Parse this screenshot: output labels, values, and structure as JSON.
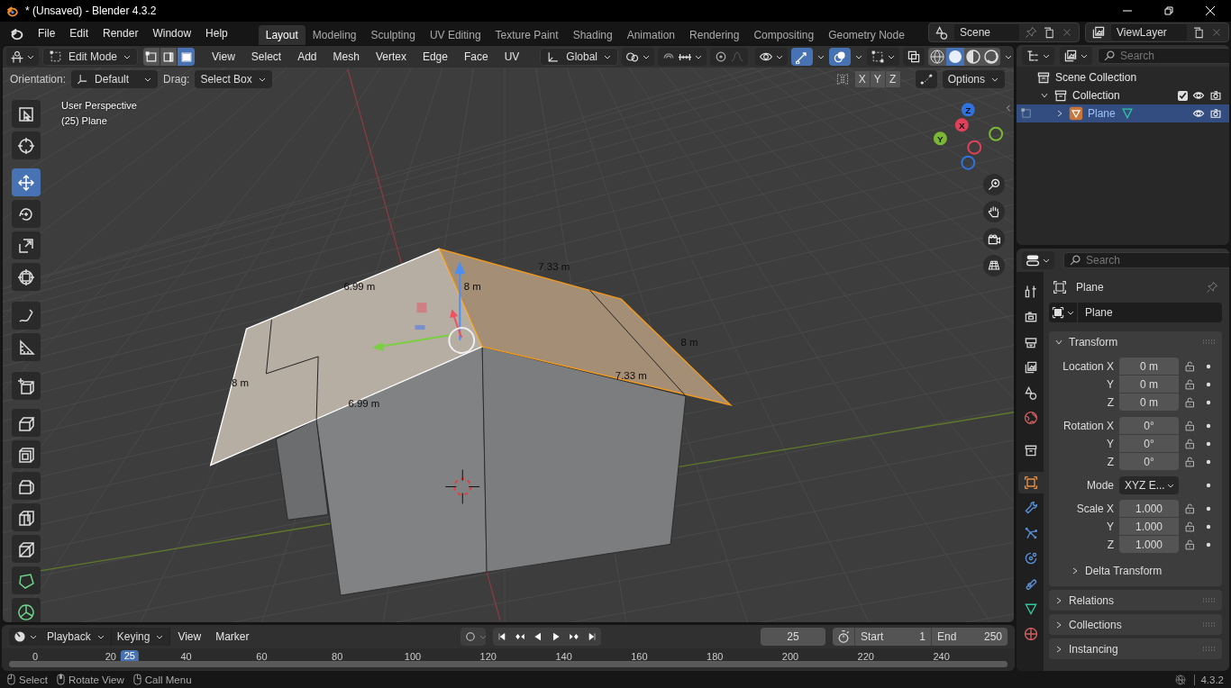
{
  "window": {
    "title": "* (Unsaved) - Blender 4.3.2"
  },
  "menu": [
    "File",
    "Edit",
    "Render",
    "Window",
    "Help"
  ],
  "workspaces": [
    {
      "label": "Layout",
      "selected": true
    },
    {
      "label": "Modeling",
      "selected": false
    },
    {
      "label": "Sculpting",
      "selected": false
    },
    {
      "label": "UV Editing",
      "selected": false
    },
    {
      "label": "Texture Paint",
      "selected": false
    },
    {
      "label": "Shading",
      "selected": false
    },
    {
      "label": "Animation",
      "selected": false
    },
    {
      "label": "Rendering",
      "selected": false
    },
    {
      "label": "Compositing",
      "selected": false
    },
    {
      "label": "Geometry Node",
      "selected": false
    }
  ],
  "scene": {
    "value": "Scene"
  },
  "view_layer": {
    "value": "ViewLayer"
  },
  "viewport_header": {
    "mode": "Edit Mode",
    "select_modes": [
      {
        "kind": "vertex",
        "selected": false
      },
      {
        "kind": "edge",
        "selected": false
      },
      {
        "kind": "face",
        "selected": true
      }
    ],
    "menus": [
      "View",
      "Select",
      "Add",
      "Mesh",
      "Vertex",
      "Edge",
      "Face",
      "UV"
    ],
    "transform_orientation": "Global"
  },
  "tool_settings": {
    "orientation_label": "Orientation:",
    "orientation": "Default",
    "drag_label": "Drag:",
    "drag": "Select Box",
    "axes": [
      "X",
      "Y",
      "Z"
    ],
    "options": "Options"
  },
  "viewport": {
    "view_name": "User Perspective",
    "object_info": "(25) Plane",
    "measurements": [
      "6.99 m",
      "8 m",
      "7.33 m",
      "8 m",
      "7.33 m",
      "8 m",
      "6.99 m"
    ],
    "gizmo_axes": [
      "Z",
      "X",
      "Y"
    ]
  },
  "toolbar": [
    {
      "kind": "select",
      "selected": false
    },
    {
      "kind": "cursor",
      "selected": false
    },
    {
      "kind": "move",
      "selected": true
    },
    {
      "kind": "rotate",
      "selected": false
    },
    {
      "kind": "scale",
      "selected": false
    },
    {
      "kind": "transform",
      "selected": false
    },
    {
      "kind": "annotate",
      "selected": false
    },
    {
      "kind": "measure",
      "selected": false
    },
    {
      "kind": "add_cube",
      "selected": false
    },
    {
      "kind": "extrude",
      "selected": false
    },
    {
      "kind": "inset",
      "selected": false
    },
    {
      "kind": "bevel",
      "selected": false
    },
    {
      "kind": "loop_cut",
      "selected": false
    },
    {
      "kind": "knife",
      "selected": false
    },
    {
      "kind": "poly_build",
      "selected": false
    },
    {
      "kind": "spin",
      "selected": false
    }
  ],
  "outliner": {
    "search_placeholder": "Search",
    "tree": [
      {
        "label": "Scene Collection",
        "children": [
          {
            "label": "Collection",
            "expanded": true,
            "checked": true,
            "children": [
              {
                "label": "Plane",
                "expanded": false,
                "selected": true
              }
            ]
          }
        ]
      }
    ]
  },
  "properties": {
    "search_placeholder": "Search",
    "object_name": "Plane",
    "data_name": "Plane",
    "tabs": [
      {
        "kind": "tool",
        "selected": false
      },
      {
        "kind": "render",
        "selected": false
      },
      {
        "kind": "output",
        "selected": false
      },
      {
        "kind": "view_layer",
        "selected": false
      },
      {
        "kind": "scene",
        "selected": false
      },
      {
        "kind": "world",
        "selected": false
      },
      {
        "kind": "collection",
        "selected": false
      },
      {
        "kind": "object",
        "selected": true
      },
      {
        "kind": "modifiers",
        "selected": false
      },
      {
        "kind": "particles",
        "selected": false
      },
      {
        "kind": "physics",
        "selected": false
      },
      {
        "kind": "constraints",
        "selected": false
      },
      {
        "kind": "data",
        "selected": false
      },
      {
        "kind": "material",
        "selected": false
      }
    ],
    "transform": {
      "title": "Transform",
      "expanded": true,
      "location": [
        {
          "label": "Location X",
          "value": "0 m"
        },
        {
          "label": "Y",
          "value": "0 m"
        },
        {
          "label": "Z",
          "value": "0 m"
        }
      ],
      "rotation": [
        {
          "label": "Rotation X",
          "value": "0°"
        },
        {
          "label": "Y",
          "value": "0°"
        },
        {
          "label": "Z",
          "value": "0°"
        }
      ],
      "mode": {
        "label": "Mode",
        "value": "XYZ E..."
      },
      "scale": [
        {
          "label": "Scale X",
          "value": "1.000"
        },
        {
          "label": "Y",
          "value": "1.000"
        },
        {
          "label": "Z",
          "value": "1.000"
        }
      ],
      "delta": {
        "title": "Delta Transform",
        "expanded": false
      }
    },
    "panels": [
      {
        "title": "Relations",
        "expanded": false
      },
      {
        "title": "Collections",
        "expanded": false
      },
      {
        "title": "Instancing",
        "expanded": false
      }
    ]
  },
  "timeline": {
    "menus": [
      "Playback",
      "Keying",
      "View",
      "Marker"
    ],
    "current_frame": "25",
    "start_label": "Start",
    "start": "1",
    "end_label": "End",
    "end": "250",
    "ticks": [
      "0",
      "20",
      "40",
      "60",
      "80",
      "100",
      "120",
      "140",
      "160",
      "180",
      "200",
      "220",
      "240"
    ],
    "playhead": "25"
  },
  "status_bar": {
    "hints": [
      "Select",
      "Rotate View",
      "Call Menu"
    ],
    "version": "4.3.2"
  }
}
